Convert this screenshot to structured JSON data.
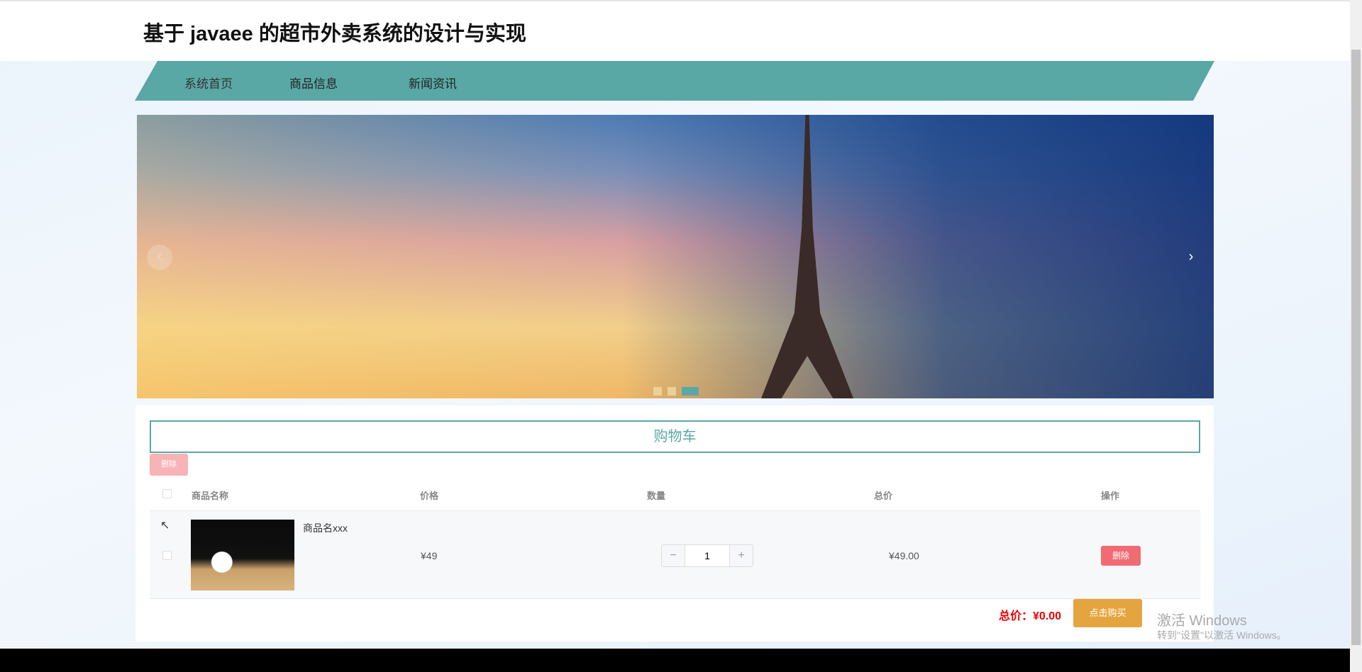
{
  "header": {
    "title": "基于 javaee 的超市外卖系统的设计与实现"
  },
  "nav": {
    "items": [
      "系统首页",
      "商品信息",
      "新闻资讯"
    ]
  },
  "banner": {
    "prev": "‹",
    "next": "›",
    "slide_count": 3,
    "active_slide": 3
  },
  "cart": {
    "title": "购物车",
    "delete_selected": "删除",
    "columns": [
      "商品名称",
      "价格",
      "数量",
      "总价",
      "操作"
    ],
    "items": [
      {
        "name": "商品名xxx",
        "price": "¥49",
        "quantity": "1",
        "subtotal": "¥49.00",
        "delete": "删除"
      }
    ],
    "total_label": "总价：",
    "total_value": "¥0.00",
    "buy_label": "点击购买"
  },
  "stepper": {
    "minus": "−",
    "plus": "+"
  },
  "watermark": {
    "line1": "激活 Windows",
    "line2": "转到\"设置\"以激活 Windows。"
  }
}
